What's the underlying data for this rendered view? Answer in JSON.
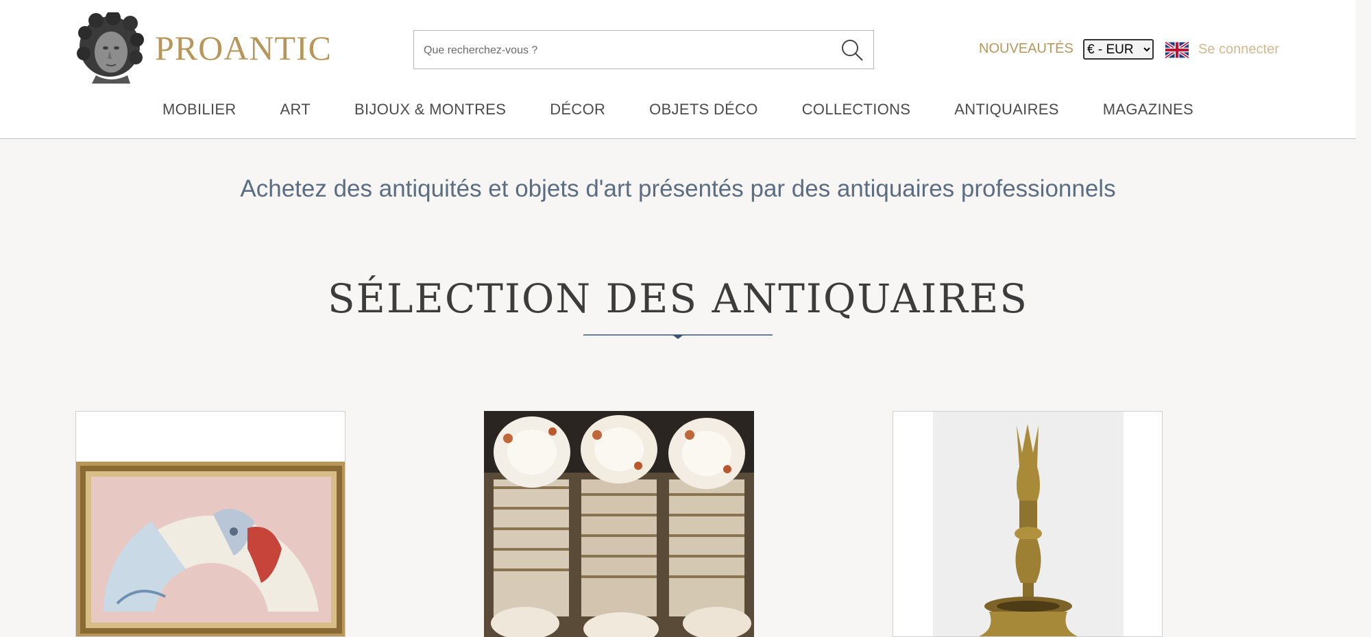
{
  "header": {
    "logo_text": "PROANTIC",
    "search_placeholder": "Que recherchez-vous ?",
    "nouveautes_label": "NOUVEAUTÉS",
    "currency_selected": "€ - EUR",
    "login_label": "Se connecter"
  },
  "nav": {
    "items": [
      {
        "label": "MOBILIER"
      },
      {
        "label": "ART"
      },
      {
        "label": "BIJOUX & MONTRES"
      },
      {
        "label": "DÉCOR"
      },
      {
        "label": "OBJETS DÉCO"
      },
      {
        "label": "COLLECTIONS"
      },
      {
        "label": "ANTIQUAIRES"
      },
      {
        "label": "MAGAZINES"
      }
    ]
  },
  "hero": {
    "tagline": "Achetez des antiquités et objets d'art présentés par des antiquaires professionnels"
  },
  "selection": {
    "title": "SÉLECTION DES ANTIQUAIRES"
  },
  "colors": {
    "gold": "#b8965a",
    "login": "#d2b98f",
    "tagline": "#5a6d82",
    "rule": "#3d5573"
  },
  "icons": {
    "search": "search-icon",
    "flag": "uk-flag-icon"
  }
}
